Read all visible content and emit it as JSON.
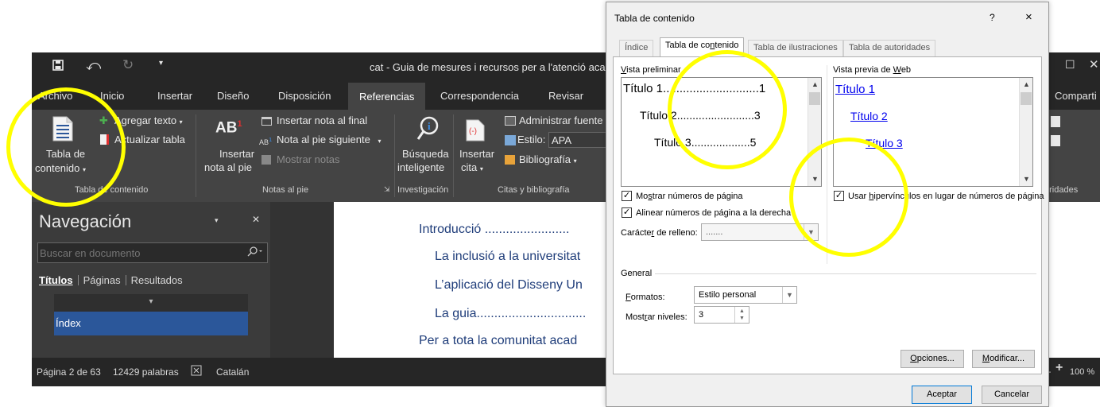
{
  "window": {
    "title": "cat - Guia de mesures i recursos per a l'atenció aca",
    "share_label": "Comparti",
    "zoom": "100 %"
  },
  "ribbon_tabs": [
    "Archivo",
    "Inicio",
    "Insertar",
    "Diseño",
    "Disposición",
    "Referencias",
    "Correspondencia",
    "Revisar"
  ],
  "ribbon": {
    "toc_group": {
      "toc_button": [
        "Tabla de",
        "contenido"
      ],
      "add_text": "Agregar texto",
      "update_table": "Actualizar tabla",
      "label": "Tabla de contenido"
    },
    "notes_group": {
      "insert_footnote": [
        "Insertar",
        "nota al pie"
      ],
      "insert_endnote": "Insertar nota al final",
      "next_footnote": "Nota al pie siguiente",
      "show_notes": "Mostrar notas",
      "label": "Notas al pie"
    },
    "research_group": {
      "smart_lookup": [
        "Búsqueda",
        "inteligente"
      ],
      "label": "Investigación"
    },
    "citations_group": {
      "insert_citation": [
        "Insertar",
        "cita"
      ],
      "manage_sources": "Administrar fuente",
      "style_label": "Estilo:",
      "style_value": "APA",
      "bibliography": "Bibliografía",
      "label": "Citas y bibliografía"
    },
    "right_partial_label": "oridades"
  },
  "navigation": {
    "title": "Navegación",
    "search_placeholder": "Buscar en documento",
    "tabs": [
      "Títulos",
      "Páginas",
      "Resultados"
    ],
    "selected_item": "Índex"
  },
  "document": {
    "lines": [
      "Introducció ........................",
      "La inclusió a la universitat",
      "L’aplicació del Disseny Un",
      "La guia...............................",
      "Per a tota la comunitat acad"
    ]
  },
  "status": {
    "page": "Página 2 de 63",
    "words": "12429 palabras",
    "language": "Catalán"
  },
  "dialog": {
    "title": "Tabla de contenido",
    "help": "?",
    "close": "×",
    "tabs": [
      "Índice",
      "Tabla de contenido",
      "Tabla de ilustraciones",
      "Tabla de autoridades"
    ],
    "print_preview_label": "Vista preliminar",
    "print_preview": [
      "Título 1.............................1",
      "Título 2.........................3",
      "Título 3...................5"
    ],
    "web_preview_label": "Vista previa de Web",
    "web_preview": [
      "Título 1",
      "Título 2",
      "Título 3"
    ],
    "show_page_numbers": "Mostrar números de página",
    "align_right": "Alinear números de página a la derecha",
    "tab_leader_label": "Carácter de relleno:",
    "tab_leader_value": ".......",
    "use_hyperlinks": "Usar hipervínculos en lugar de números de página",
    "general_label": "General",
    "formats_label": "Formatos:",
    "formats_value": "Estilo personal",
    "levels_label": "Mostrar niveles:",
    "levels_value": "3",
    "options_button": "Opciones...",
    "modify_button": "Modificar...",
    "ok_button": "Aceptar",
    "cancel_button": "Cancelar"
  },
  "annotation_color": "#ffff00"
}
